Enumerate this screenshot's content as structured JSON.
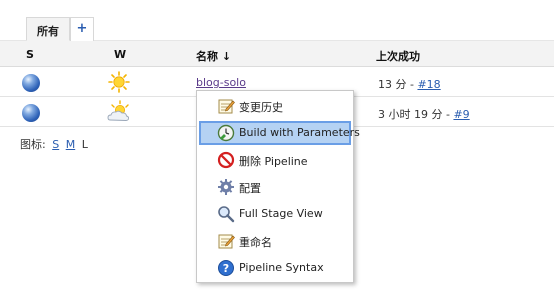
{
  "tabs": {
    "active_label": "所有",
    "add_label": "+"
  },
  "table": {
    "headers": {
      "s": "S",
      "w": "W",
      "name": "名称",
      "sort_arrow": "↓",
      "last_success": "上次成功"
    },
    "rows": [
      {
        "name": "blog-solo",
        "last_success_prefix": "13 分 - ",
        "build": "#18",
        "weather": "sunny-icon"
      },
      {
        "name": "",
        "last_success_prefix": "3 小时 19 分 - ",
        "build": "#9",
        "weather": "partly-cloudy-icon"
      }
    ]
  },
  "legend": {
    "label": "图标:",
    "s": "S",
    "m": "M",
    "l": "L"
  },
  "context_menu": {
    "items": [
      {
        "label": "变更历史",
        "icon": "notepad-icon"
      },
      {
        "label": "Build with Parameters",
        "icon": "build-clock-icon"
      },
      {
        "label": "删除 Pipeline",
        "icon": "no-entry-icon"
      },
      {
        "label": "配置",
        "icon": "gear-icon"
      },
      {
        "label": "Full Stage View",
        "icon": "magnifier-icon"
      },
      {
        "label": "重命名",
        "icon": "notepad-pencil-icon"
      },
      {
        "label": "Pipeline Syntax",
        "icon": "help-icon"
      }
    ]
  }
}
